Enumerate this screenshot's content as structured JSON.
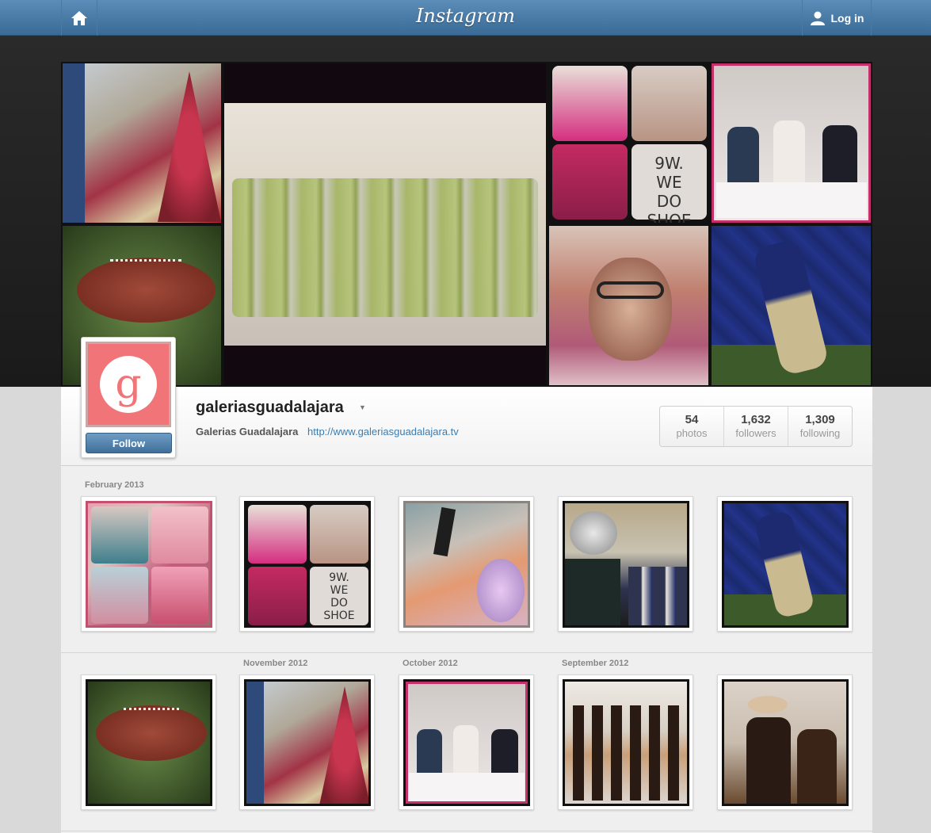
{
  "topbar": {
    "brand": "Instagram",
    "login_label": "Log in",
    "accent_color": "#3a6a96"
  },
  "profile": {
    "username": "galeriasguadalajara",
    "full_name": "Galerias Guadalajara",
    "website": "http://www.galeriasguadalajara.tv",
    "avatar_letter": "g",
    "follow_label": "Follow",
    "stats": [
      {
        "value": "54",
        "label": "photos"
      },
      {
        "value": "1,632",
        "label": "followers"
      },
      {
        "value": "1,309",
        "label": "following"
      }
    ]
  },
  "feed": {
    "rows": [
      {
        "date_labels": [
          "February 2013"
        ],
        "photos": [
          {
            "name": "swimwear-mannequins-photo",
            "colors": [
              "#e7a0b0",
              "#c65b7c",
              "#9b6f70"
            ]
          },
          {
            "name": "pink-ottoman-shoes-photo",
            "colors": [
              "#d5317f",
              "#b8b1a8",
              "#5a4a48"
            ],
            "caption": "9W. WE DO SHOE"
          },
          {
            "name": "cakes-display-photo",
            "colors": [
              "#e49a72",
              "#7a8a84",
              "#d7b2c3"
            ]
          },
          {
            "name": "football-players-photo",
            "colors": [
              "#2e3350",
              "#b8a88a",
              "#1d1d1d"
            ]
          },
          {
            "name": "nfl-player-statue-photo",
            "colors": [
              "#1f2a66",
              "#c9bb8f",
              "#3d5a2a"
            ]
          }
        ]
      },
      {
        "date_labels": [
          "November 2012",
          "October 2012",
          "September 2012"
        ],
        "photos": [
          {
            "name": "nfl-football-photo",
            "colors": [
              "#4f6c3a",
              "#8a3a2a",
              "#2a3a20"
            ]
          },
          {
            "name": "christmas-tree-photo",
            "colors": [
              "#b83a5a",
              "#d8c0a0",
              "#3a5a8a"
            ]
          },
          {
            "name": "three-people-photo",
            "colors": [
              "#ddd8d6",
              "#2a3a50",
              "#c06a8a"
            ]
          },
          {
            "name": "mariachi-band-photo",
            "colors": [
              "#2a1a14",
              "#c9a07a",
              "#eeeae4"
            ]
          },
          {
            "name": "mariachi-singer-photo",
            "colors": [
              "#2a1a14",
              "#c9a07a",
              "#dcd2c8"
            ]
          }
        ]
      }
    ]
  }
}
